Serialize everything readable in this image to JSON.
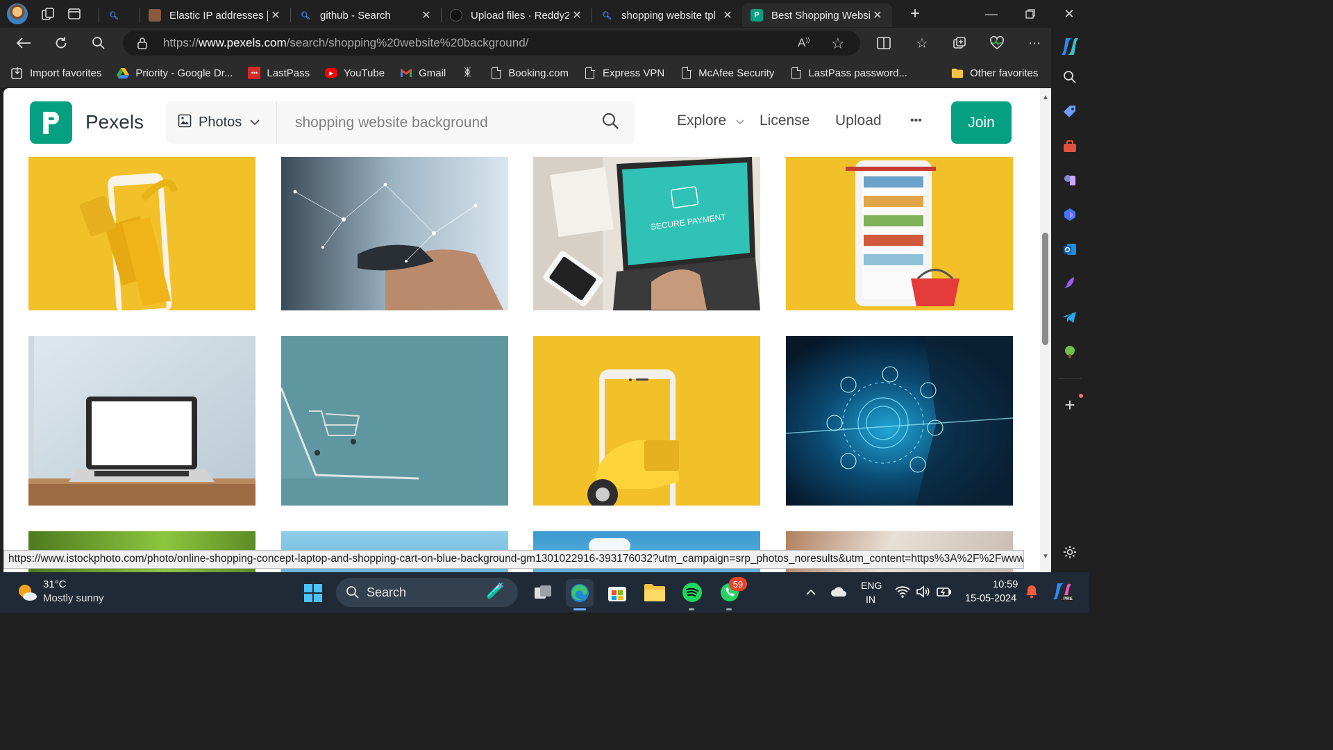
{
  "browser": {
    "tabs": [
      {
        "title": "",
        "icon": "search-icon",
        "color": "#3b82f6"
      },
      {
        "title": "Elastic IP addresses |",
        "icon": "aws-cube-icon",
        "color": "#8a5a3c"
      },
      {
        "title": "github - Search",
        "icon": "search-icon",
        "color": "#3b82f6"
      },
      {
        "title": "Upload files · Reddy2",
        "icon": "github-icon",
        "color": "#222222"
      },
      {
        "title": "shopping website tpl",
        "icon": "search-icon",
        "color": "#3b82f6"
      },
      {
        "title": "Best Shopping Websi",
        "icon": "pexels-icon",
        "color": "#05a081",
        "active": true
      }
    ],
    "url_scheme": "https://",
    "url_host": "www.pexels.com",
    "url_path": "/search/shopping%20website%20background/",
    "favorites": [
      {
        "label": "Import favorites",
        "icon": "import-icon"
      },
      {
        "label": "Priority - Google Dr...",
        "icon": "google-drive-icon"
      },
      {
        "label": "LastPass",
        "icon": "lastpass-icon"
      },
      {
        "label": "YouTube",
        "icon": "youtube-icon"
      },
      {
        "label": "Gmail",
        "icon": "gmail-icon"
      },
      {
        "label": "",
        "icon": "butterfly-icon"
      },
      {
        "label": "Booking.com",
        "icon": "page-icon"
      },
      {
        "label": "Express VPN",
        "icon": "page-icon"
      },
      {
        "label": "McAfee Security",
        "icon": "page-icon"
      },
      {
        "label": "LastPass password...",
        "icon": "page-icon"
      }
    ],
    "other_favorites": "Other favorites",
    "status_url": "https://www.istockphoto.com/photo/online-shopping-concept-laptop-and-shopping-cart-on-blue-background-gm1301022916-393176032?utm_campaign=srp_photos_noresults&utm_content=https%3A%2F%2Fwww.pexel..."
  },
  "site": {
    "brand": "Pexels",
    "logo_letter": "P",
    "search_type": "Photos",
    "search_query": "shopping website background",
    "nav": {
      "explore": "Explore",
      "license": "License",
      "upload": "Upload",
      "more": "•••"
    },
    "join": "Join",
    "accent": "#05a081",
    "photos": [
      {
        "subject": "phone with shopping bags on yellow"
      },
      {
        "subject": "hands holding phone with network lines"
      },
      {
        "subject": "laptop showing secure payment"
      },
      {
        "subject": "phone as store shelf with basket"
      },
      {
        "subject": "laptop on wooden table"
      },
      {
        "subject": "laptop with shopping cart on blue"
      },
      {
        "subject": "phone with yellow scooter"
      },
      {
        "subject": "business person digital network"
      }
    ],
    "payment_text": "SECURE PAYMENT"
  },
  "taskbar": {
    "temperature": "31°C",
    "weather": "Mostly sunny",
    "search_label": "Search",
    "whatsapp_badge": "59",
    "language": "ENG",
    "region": "IN",
    "time": "10:59",
    "date": "15-05-2024"
  }
}
